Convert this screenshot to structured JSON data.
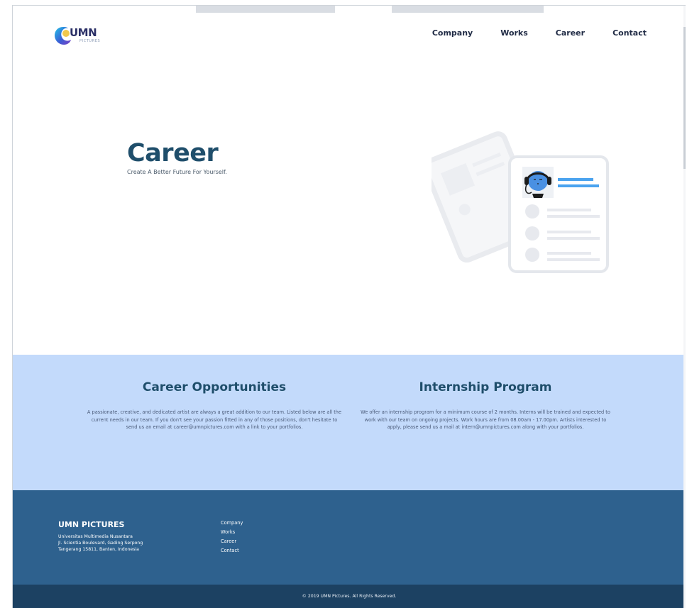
{
  "brand": {
    "logo_text": "UMN",
    "logo_sub": "PICTURES"
  },
  "nav": {
    "items": [
      "Company",
      "Works",
      "Career",
      "Contact"
    ]
  },
  "hero": {
    "title": "Career",
    "subtitle": "Create A Better Future For Yourself."
  },
  "opportunities": {
    "title": "Career Opportunities",
    "body": "A passionate, creative, and dedicated artist are always a great addition to our team. Listed below are all the current needs in our team. If you don't see your passion fitted in any of those positions, don't hesitate to send us an email at career@umnpictures.com with a link to your portfolios."
  },
  "internship": {
    "title": "Internship Program",
    "body": "We offer an internship program for a minimum course of 2 months. Interns will be trained and expected to work with our team on ongoing projects. Work hours are from 08.00am - 17.00pm. Artists interested to apply, please send us a mail at intern@umnpictures.com along with your portfolios."
  },
  "footer": {
    "brand": "UMN PICTURES",
    "address": [
      "Universitas Multimedia Nusantara",
      "Jl. Scientia Boulevard, Gading Serpong",
      "Tangerang 15811, Banten, Indonesia"
    ],
    "links": [
      "Company",
      "Works",
      "Career",
      "Contact"
    ],
    "copyright": "© 2019 UMN Pictures. All Rights Reserved."
  },
  "colors": {
    "primary": "#1f4e6b",
    "light_blue_section": "#c3dafb",
    "footer": "#2e618e",
    "footer_bottom": "#1c4162",
    "accent": "#4aa3ef"
  }
}
